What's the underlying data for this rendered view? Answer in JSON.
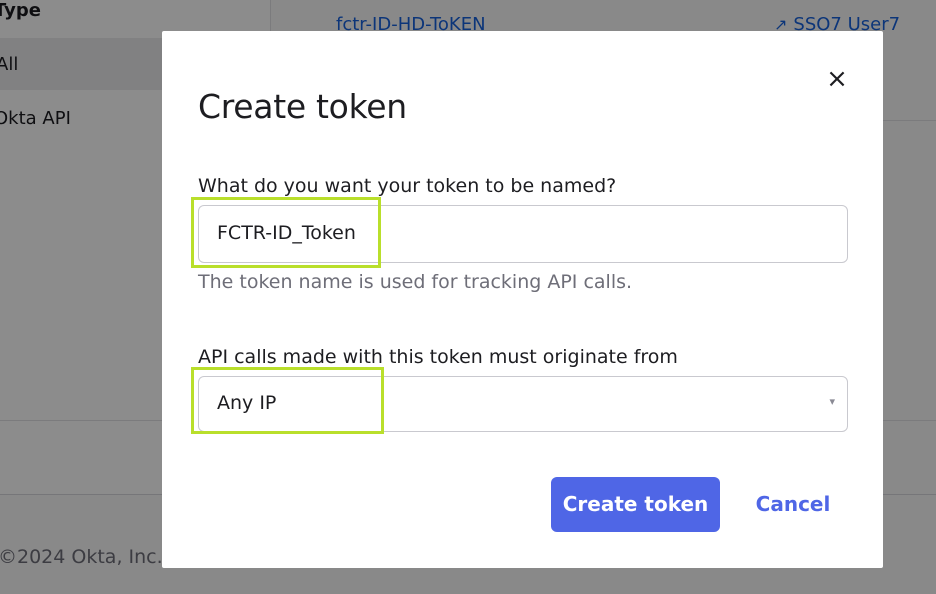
{
  "background": {
    "table_header": "Type",
    "filter_all": "All",
    "filter_okta_api": "Okta API",
    "token_name_link": "fctr-ID-HD-ToKEN",
    "created_by_link": "SSO7 User7",
    "footer_copyright": "2024 Okta, Inc."
  },
  "modal": {
    "title": "Create token",
    "close_icon": "×",
    "name_field": {
      "label": "What do you want your token to be named?",
      "value": "FCTR-ID_Token",
      "helper": "The token name is used for tracking API calls."
    },
    "origin_field": {
      "label": "API calls made with this token must originate from",
      "selected": "Any IP",
      "caret": "▾"
    },
    "create_button": "Create token",
    "cancel_button": "Cancel"
  },
  "colors": {
    "primary": "#4f66e6",
    "highlight": "#b9df2b",
    "overlay": "rgba(0,0,0,0.45)"
  }
}
